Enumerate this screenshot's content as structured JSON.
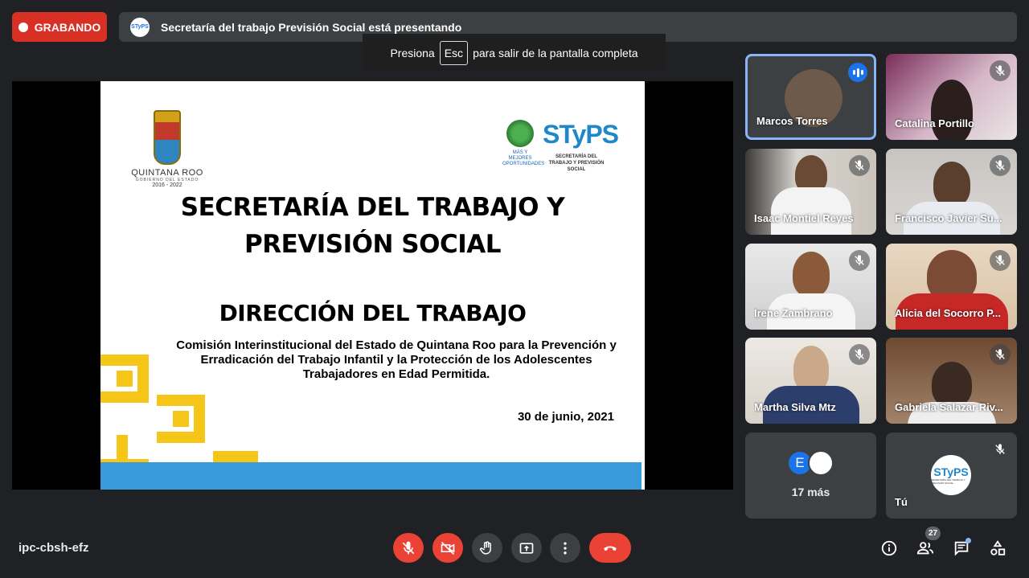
{
  "recording": {
    "label": "GRABANDO",
    "color": "#d93025"
  },
  "presenting": {
    "logo_text": "STyPS",
    "text": "Secretaría del trabajo Previsión Social está presentando"
  },
  "fullscreen_toast": {
    "before": "Presiona",
    "key": "Esc",
    "after": "para salir de la pantalla completa"
  },
  "slide": {
    "gov_name": "QUINTANA ROO",
    "gov_sub": "GOBIERNO DEL ESTADO",
    "gov_years": "2016 - 2022",
    "tree_text": "MÁS Y MEJORES OPORTUNIDADES",
    "styps": "STyPS",
    "styps_sub": "SECRETARÍA DEL TRABAJO Y PREVISIÓN SOCIAL",
    "title_line1": "SECRETARÍA DEL TRABAJO Y",
    "title_line2": "PREVISIÓN SOCIAL",
    "subtitle": "DIRECCIÓN DEL TRABAJO",
    "description": "Comisión Interinstitucional del Estado de Quintana Roo para la Prevención y Erradicación del Trabajo Infantil y la Protección de los Adolescentes Trabajadores en Edad Permitida.",
    "date": "30 de junio, 2021"
  },
  "participants": [
    {
      "name": "Marcos Torres",
      "status": "speaking"
    },
    {
      "name": "Catalina Portillo",
      "status": "muted"
    },
    {
      "name": "Isaac Montiel Reyes",
      "status": "muted"
    },
    {
      "name": "Francisco Javier Su...",
      "status": "muted"
    },
    {
      "name": "Irene Zambrano",
      "status": "muted"
    },
    {
      "name": "Alicia del Socorro P...",
      "status": "muted"
    },
    {
      "name": "Martha Silva Mtz",
      "status": "muted"
    },
    {
      "name": "Gabriela Salazar Riv...",
      "status": "muted"
    }
  ],
  "more": {
    "avatar_letter": "E",
    "label": "17 más"
  },
  "self": {
    "label": "Tú",
    "logo": "STyPS",
    "logo_sub": "SECRETARÍA DEL TRABAJO Y PREVISIÓN SOCIAL"
  },
  "bottom": {
    "meeting_code": "ipc-cbsh-efz",
    "participant_count": "27",
    "controls": [
      "mic-off-icon",
      "camera-off-icon",
      "raise-hand-icon",
      "present-icon",
      "more-options-icon",
      "hang-up-icon"
    ],
    "side": [
      "info-icon",
      "people-icon",
      "chat-icon",
      "activities-icon"
    ]
  }
}
